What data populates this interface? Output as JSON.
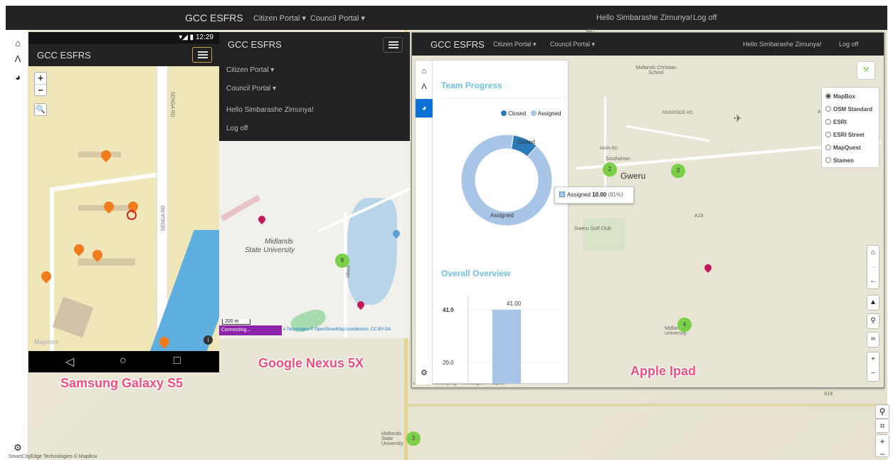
{
  "background": {
    "brand": "GCC ESFRS",
    "nav": [
      "Citizen Portal",
      "Council Portal"
    ],
    "greeting": "Hello Simbarashe Zimunya!",
    "logoff": "Log off",
    "attribution": "SmartCityEdge Technologies © MapBox",
    "map_labels": [
      "A17",
      "A18",
      "Midlands State University"
    ],
    "cluster_count": "3"
  },
  "samsung": {
    "label": "Samsung Galaxy S5",
    "status_time": "12:29",
    "brand": "GCC ESFRS",
    "road_label_1": "SENGA RD",
    "road_label_2": "SENGA RD",
    "zoom_in": "+",
    "zoom_out": "−",
    "map_attribution": "Mapbox",
    "nav_back": "◁",
    "nav_home": "○",
    "nav_recent": "□"
  },
  "nexus": {
    "label": "Google Nexus 5X",
    "brand": "GCC ESFRS",
    "menu": [
      "Citizen Portal",
      "Council Portal",
      "Hello Simbarashe Zimunya!",
      "Log off"
    ],
    "map_title_line1": "Midlands",
    "map_title_line2": "State University",
    "road_label": "Senga",
    "scale": "200 m",
    "status": "Connecting...",
    "attribution": "e Tecnologies © OpenStreetMap contributors, CC-BY-SA",
    "clusters": [
      "8",
      "3"
    ]
  },
  "ipad": {
    "label": "Apple Ipad",
    "brand": "GCC ESFRS",
    "nav": [
      "Citizen Portal",
      "Council Portal"
    ],
    "greeting": "Hello Simbarashe Zimunya!",
    "logoff": "Log off",
    "layers": [
      {
        "name": "MapBox",
        "selected": true
      },
      {
        "name": "OSM Standard",
        "selected": false
      },
      {
        "name": "ESRI",
        "selected": false
      },
      {
        "name": "ESRI Street",
        "selected": false
      },
      {
        "name": "MapQuest",
        "selected": false
      },
      {
        "name": "Stamen",
        "selected": false
      }
    ],
    "map_labels": [
      "Midlands Christian School",
      "Southdown",
      "Gweru",
      "Gweru Golf Club",
      "Midlands University",
      "A18",
      "A17",
      "MAIN RD",
      "RIVERSIDE RD"
    ],
    "clusters": [
      "2",
      "3",
      "4"
    ],
    "attribution": "Leaflet | SmartCityEdge Technologies © Mapbox",
    "tooltip": {
      "series": "Assigned",
      "value": "10.00",
      "pct": "(91%)"
    },
    "team_progress": {
      "title": "Team Progress",
      "legend": [
        {
          "name": "Closed",
          "color": "#2b7bb9"
        },
        {
          "name": "Assigned",
          "color": "#a8c4e6"
        }
      ],
      "slice_labels": {
        "closed": "Closed",
        "assigned": "Assigned"
      }
    },
    "overall_overview": {
      "title": "Overall Overview",
      "bar_label": "41.00",
      "ticks": [
        "41.0",
        "20.0"
      ]
    }
  },
  "chart_data": [
    {
      "type": "pie",
      "title": "Team Progress",
      "categories": [
        "Closed",
        "Assigned"
      ],
      "values": [
        1,
        10
      ],
      "percentages": [
        9,
        91
      ],
      "colors": [
        "#2b7bb9",
        "#a8c4e6"
      ],
      "donut": true,
      "legend": "top"
    },
    {
      "type": "bar",
      "title": "Overall Overview",
      "categories": [
        ""
      ],
      "values": [
        41.0
      ],
      "data_labels": [
        "41.00"
      ],
      "yticks": [
        20.0,
        41.0
      ],
      "colors": [
        "#a8c4e6"
      ]
    }
  ]
}
